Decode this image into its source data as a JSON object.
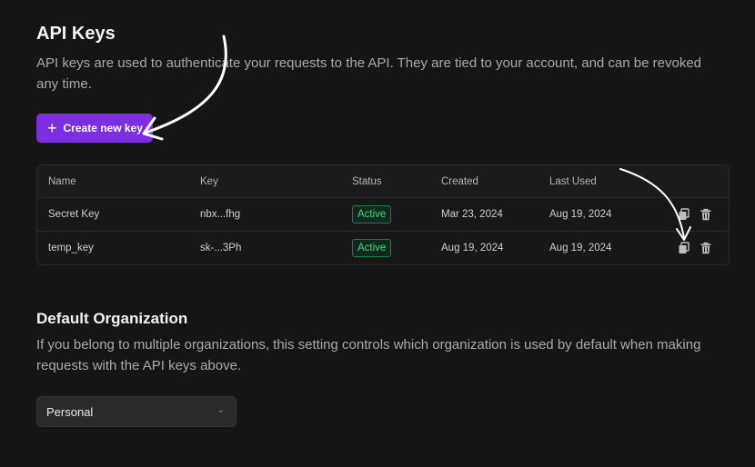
{
  "api": {
    "title": "API Keys",
    "description": "API keys are used to authenticate your requests to the API. They are tied to your account, and can be revoked any time.",
    "create_button": "Create new key",
    "table": {
      "headers": [
        "Name",
        "Key",
        "Status",
        "Created",
        "Last Used"
      ],
      "rows": [
        {
          "name": "Secret Key",
          "key": "nbx...fhg",
          "status": "Active",
          "created": "Mar 23, 2024",
          "last_used": "Aug 19, 2024"
        },
        {
          "name": "temp_key",
          "key": "sk-...3Ph",
          "status": "Active",
          "created": "Aug 19, 2024",
          "last_used": "Aug 19, 2024"
        }
      ]
    }
  },
  "org": {
    "title": "Default Organization",
    "description": "If you belong to multiple organizations, this setting controls which organization is used by default when making requests with the API keys above.",
    "select_value": "Personal"
  },
  "colors": {
    "accent": "#7c2ee0",
    "status_active": "#3fd98a",
    "background": "#151515"
  }
}
